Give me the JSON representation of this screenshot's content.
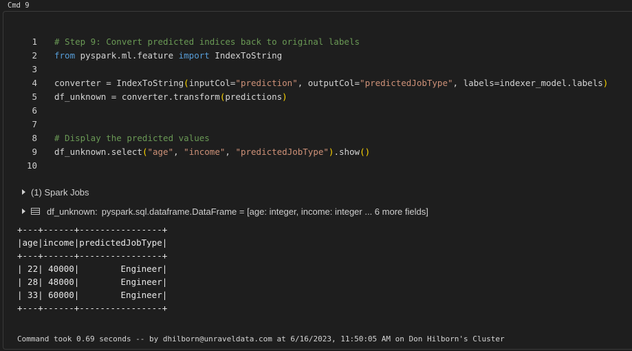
{
  "cmd_label": "Cmd 9",
  "code_lines": [
    {
      "n": "1",
      "tokens": [
        {
          "t": "# Step 9: Convert predicted indices back to original labels",
          "c": "comment"
        }
      ]
    },
    {
      "n": "2",
      "tokens": [
        {
          "t": "from",
          "c": "kw"
        },
        {
          "t": " pyspark.ml.feature ",
          "c": "plain"
        },
        {
          "t": "import",
          "c": "kw"
        },
        {
          "t": " IndexToString",
          "c": "plain"
        }
      ]
    },
    {
      "n": "3",
      "tokens": []
    },
    {
      "n": "4",
      "tokens": [
        {
          "t": "converter = IndexToString",
          "c": "plain"
        },
        {
          "t": "(",
          "c": "paren"
        },
        {
          "t": "inputCol=",
          "c": "plain"
        },
        {
          "t": "\"prediction\"",
          "c": "str"
        },
        {
          "t": ", outputCol=",
          "c": "plain"
        },
        {
          "t": "\"predictedJobType\"",
          "c": "str"
        },
        {
          "t": ", labels=indexer_model.labels",
          "c": "plain"
        },
        {
          "t": ")",
          "c": "paren"
        }
      ]
    },
    {
      "n": "5",
      "tokens": [
        {
          "t": "df_unknown = converter.transform",
          "c": "plain"
        },
        {
          "t": "(",
          "c": "paren"
        },
        {
          "t": "predictions",
          "c": "plain"
        },
        {
          "t": ")",
          "c": "paren"
        }
      ]
    },
    {
      "n": "6",
      "tokens": []
    },
    {
      "n": "7",
      "tokens": []
    },
    {
      "n": "8",
      "tokens": [
        {
          "t": "# Display the predicted values",
          "c": "comment"
        }
      ]
    },
    {
      "n": "9",
      "tokens": [
        {
          "t": "df_unknown.select",
          "c": "plain"
        },
        {
          "t": "(",
          "c": "paren"
        },
        {
          "t": "\"age\"",
          "c": "str"
        },
        {
          "t": ", ",
          "c": "plain"
        },
        {
          "t": "\"income\"",
          "c": "str"
        },
        {
          "t": ", ",
          "c": "plain"
        },
        {
          "t": "\"predictedJobType\"",
          "c": "str"
        },
        {
          "t": ")",
          "c": "paren"
        },
        {
          "t": ".show",
          "c": "plain"
        },
        {
          "t": "()",
          "c": "paren"
        }
      ]
    },
    {
      "n": "10",
      "tokens": []
    }
  ],
  "spark_jobs_label": "(1) Spark Jobs",
  "dataframe": {
    "name": "df_unknown:",
    "type": "pyspark.sql.dataframe.DataFrame = [age: integer, income: integer ... 6 more fields]"
  },
  "output_lines": [
    "+---+------+----------------+",
    "|age|income|predictedJobType|",
    "+---+------+----------------+",
    "| 22| 40000|        Engineer|",
    "| 28| 48000|        Engineer|",
    "| 33| 60000|        Engineer|",
    "+---+------+----------------+"
  ],
  "footer": "Command took 0.69 seconds -- by dhilborn@unraveldata.com at 6/16/2023, 11:50:05 AM on Don Hilborn's Cluster"
}
